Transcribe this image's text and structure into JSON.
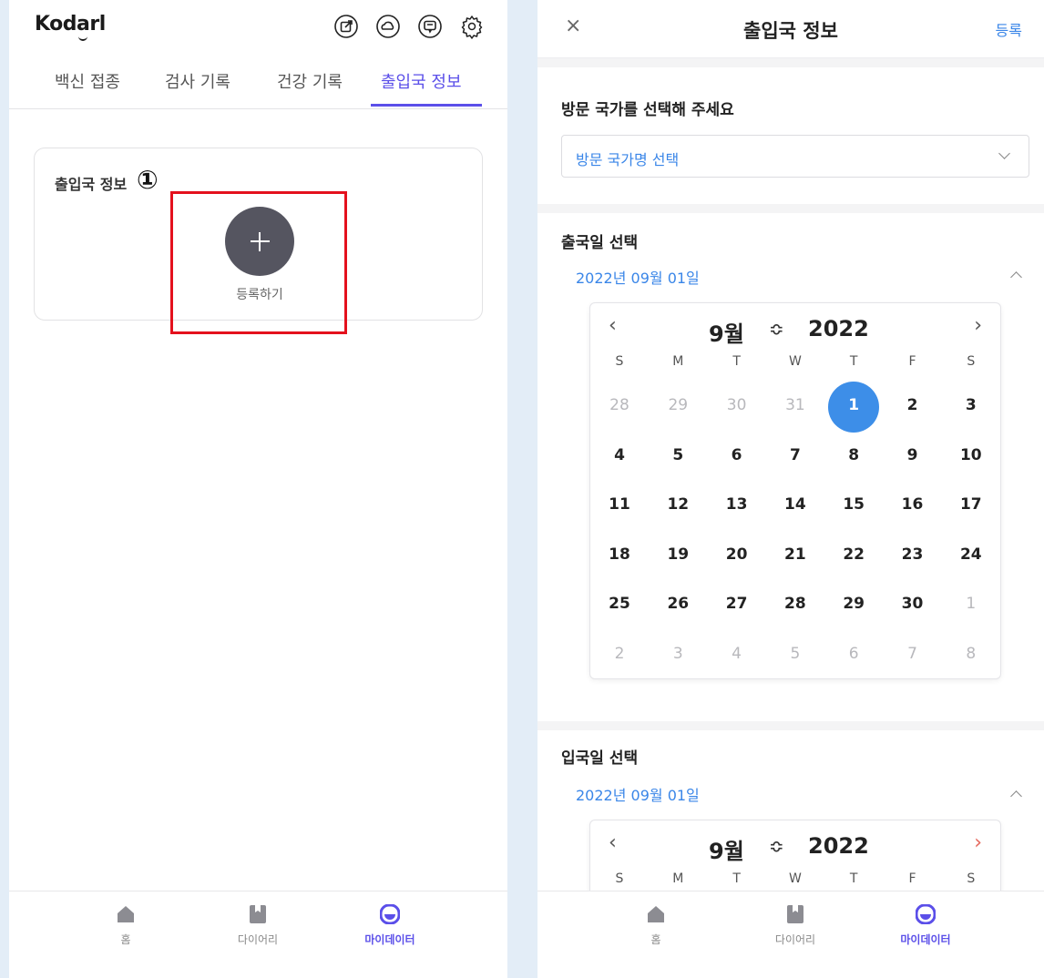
{
  "left": {
    "logo": "Kodarl",
    "tabs": [
      {
        "label": "백신 접종"
      },
      {
        "label": "검사 기록"
      },
      {
        "label": "건강 기록"
      },
      {
        "label": "출입국 정보"
      }
    ],
    "card": {
      "title": "출입국 정보",
      "step_marker": "①",
      "add_label": "등록하기"
    },
    "nav": [
      {
        "label": "홈"
      },
      {
        "label": "다이어리"
      },
      {
        "label": "마이데이터"
      }
    ]
  },
  "right": {
    "header": {
      "close": "×",
      "title": "출입국 정보",
      "register": "등록"
    },
    "country": {
      "title": "방문 국가를 선택해 주세요",
      "placeholder": "방문 국가명 선택"
    },
    "departure": {
      "title": "출국일 선택",
      "date": "2022년 09월 01일",
      "calendar": {
        "month": "9월",
        "toggle": "≎",
        "year": "2022",
        "prev": "‹",
        "next": "›",
        "weekdays": [
          "S",
          "M",
          "T",
          "W",
          "T",
          "F",
          "S"
        ],
        "weeks": [
          [
            "28",
            "29",
            "30",
            "31",
            "1",
            "2",
            "3"
          ],
          [
            "4",
            "5",
            "6",
            "7",
            "8",
            "9",
            "10"
          ],
          [
            "11",
            "12",
            "13",
            "14",
            "15",
            "16",
            "17"
          ],
          [
            "18",
            "19",
            "20",
            "21",
            "22",
            "23",
            "24"
          ],
          [
            "25",
            "26",
            "27",
            "28",
            "29",
            "30",
            "1"
          ],
          [
            "2",
            "3",
            "4",
            "5",
            "6",
            "7",
            "8"
          ]
        ],
        "selected": "1"
      }
    },
    "arrival": {
      "title": "입국일 선택",
      "date": "2022년 09월 01일",
      "calendar": {
        "month": "9월",
        "toggle": "≎",
        "year": "2022",
        "prev": "‹",
        "next": "›",
        "weekdays": [
          "S",
          "M",
          "T",
          "W",
          "T",
          "F",
          "S"
        ]
      }
    },
    "nav": [
      {
        "label": "홈"
      },
      {
        "label": "다이어리"
      },
      {
        "label": "마이데이터"
      }
    ]
  },
  "colors": {
    "accent": "#5b4fe9",
    "link": "#3a86e8",
    "selected_day": "#3d8ee8",
    "highlight": "#e4111d"
  }
}
